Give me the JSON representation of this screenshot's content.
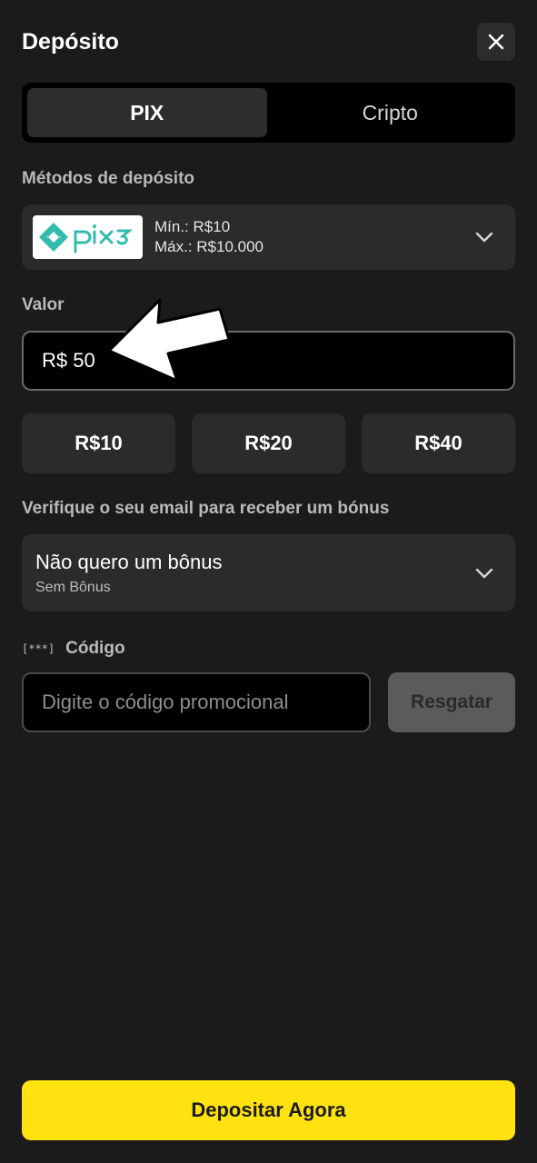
{
  "header": {
    "title": "Depósito",
    "close_icon": "close-icon"
  },
  "tabs": [
    {
      "label": "PIX",
      "active": true
    },
    {
      "label": "Cripto",
      "active": false
    }
  ],
  "methods": {
    "label": "Métodos de depósito",
    "selected": {
      "logo_text": "pix3",
      "min": "Mín.: R$10",
      "max": "Máx.: R$10.000"
    }
  },
  "value": {
    "label": "Valor",
    "current": "R$ 50"
  },
  "quick_amounts": [
    "R$10",
    "R$20",
    "R$40"
  ],
  "bonus": {
    "label": "Verifique o seu email para receber um bónus",
    "selected_title": "Não quero um bônus",
    "selected_subtitle": "Sem Bônus"
  },
  "code": {
    "icon_text": "[***]",
    "label": "Código",
    "placeholder": "Digite o código promocional",
    "redeem_label": "Resgatar"
  },
  "submit": {
    "label": "Depositar Agora"
  },
  "colors": {
    "background": "#1b1b1b",
    "surface": "#2b2b2b",
    "accent": "#ffe20f",
    "pix_teal": "#32bcad"
  }
}
